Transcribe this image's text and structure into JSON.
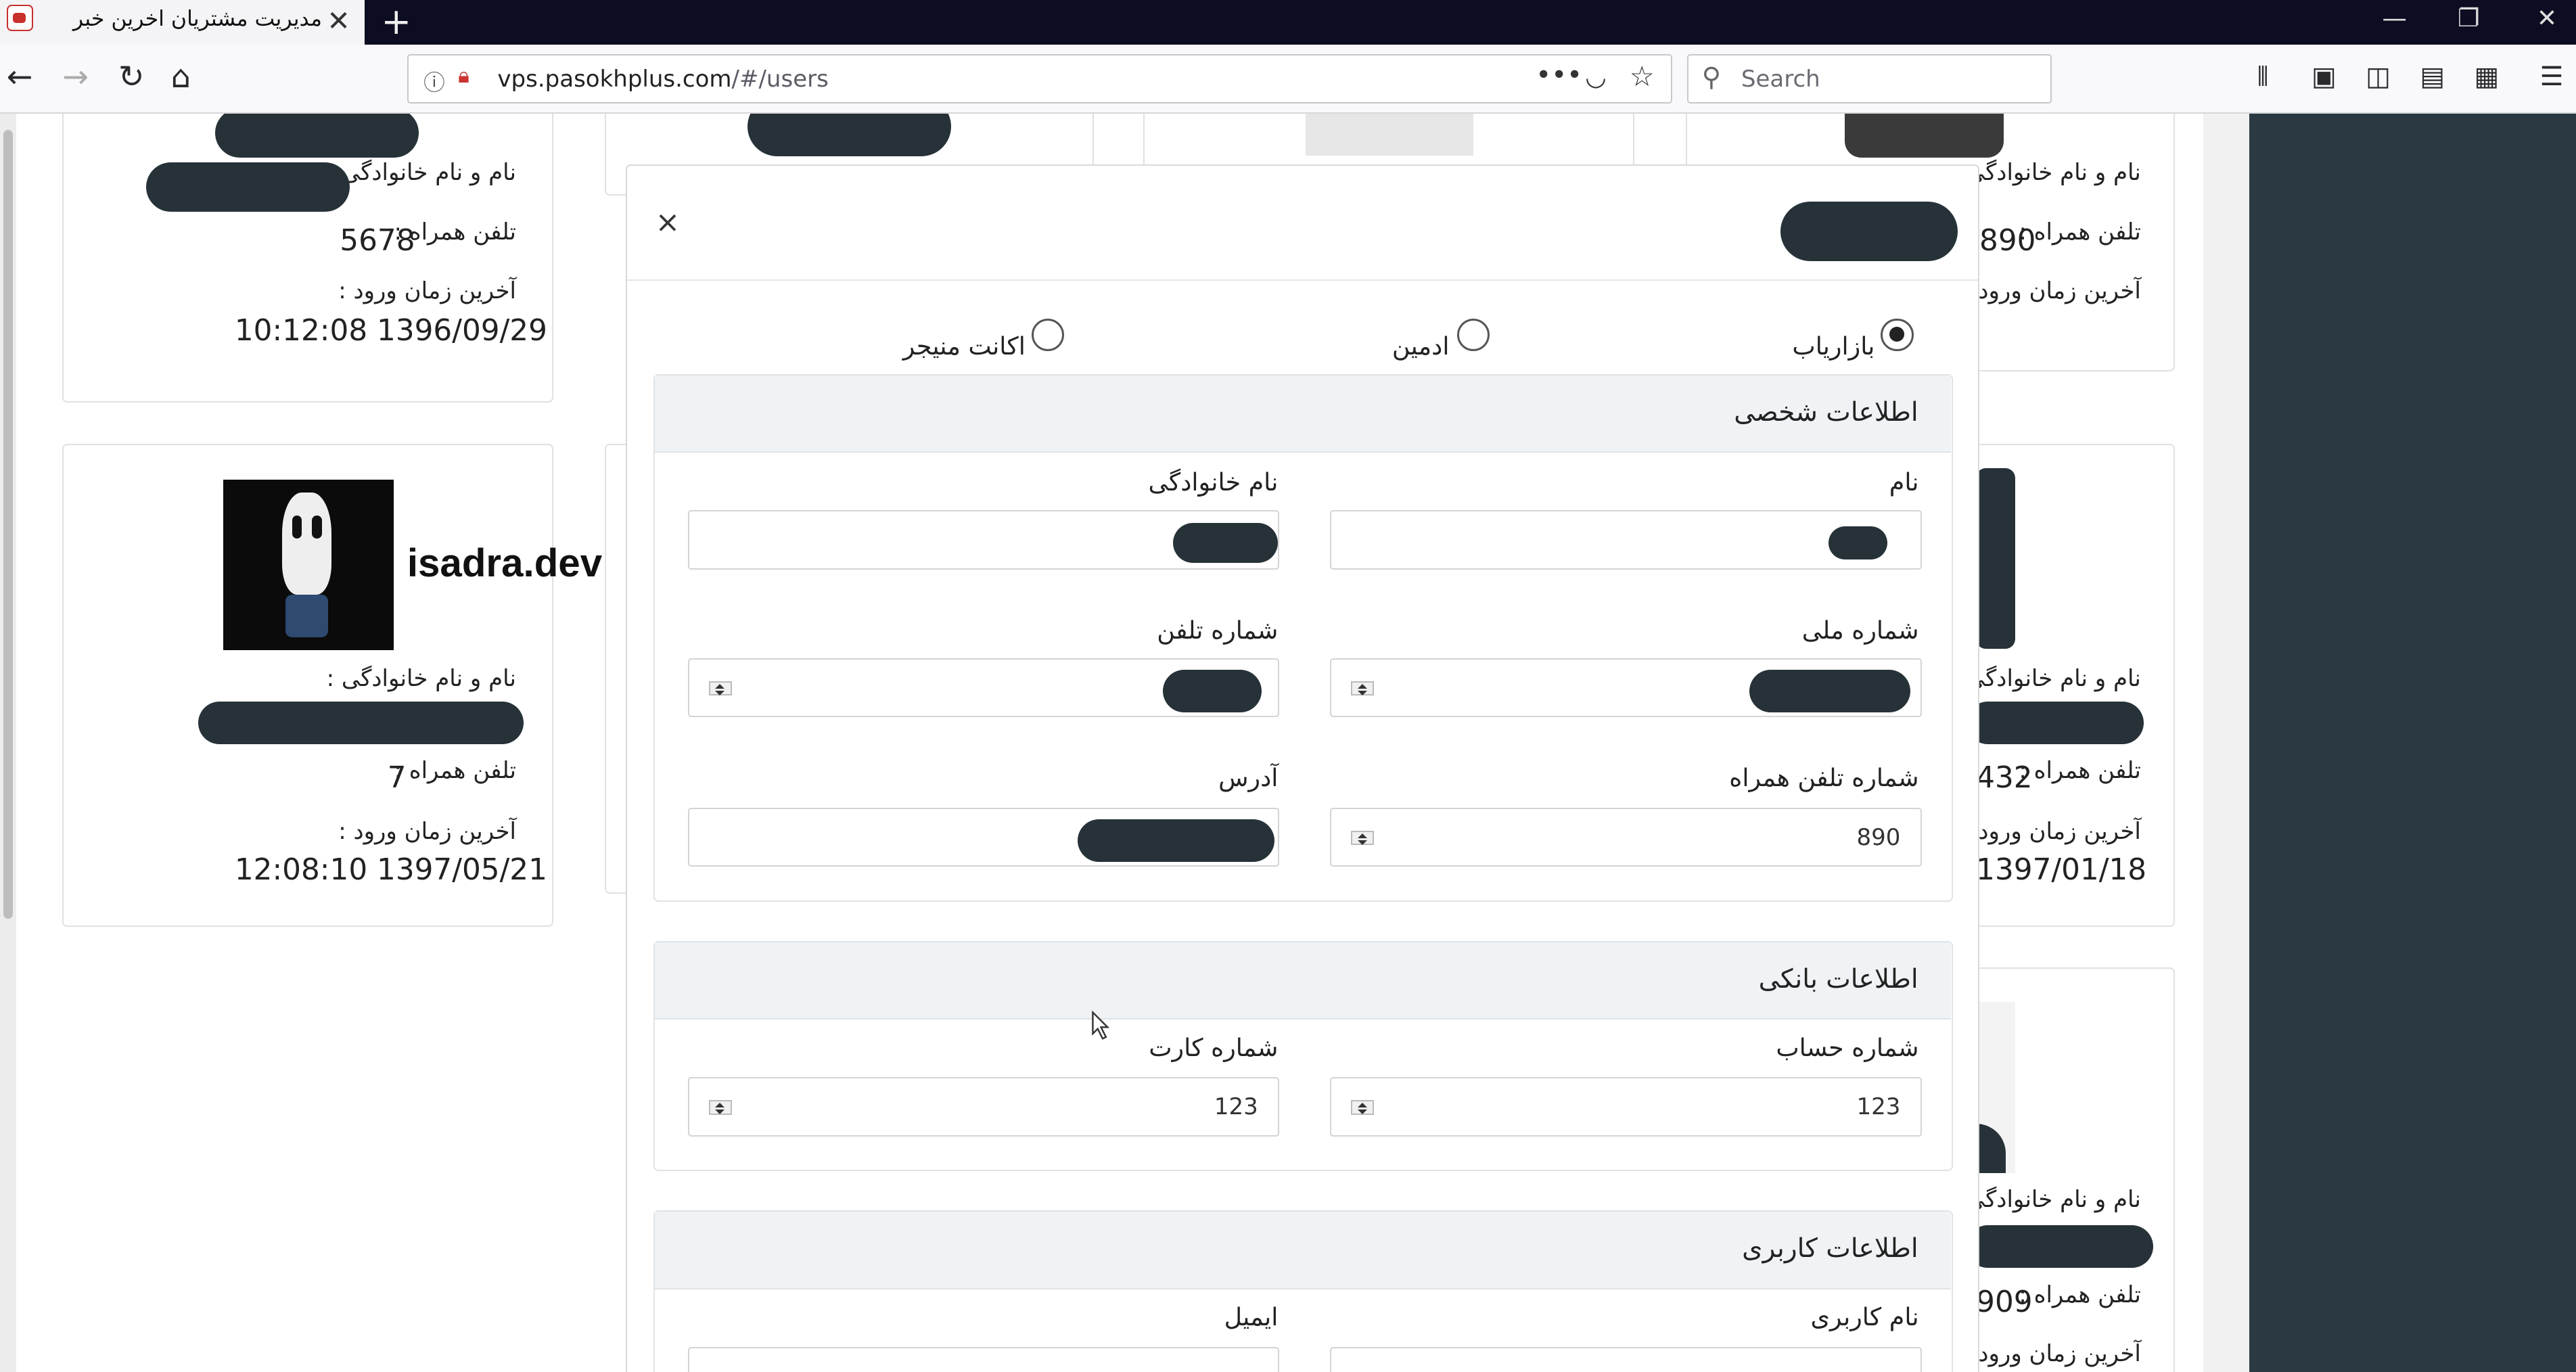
{
  "browser": {
    "tab_title": "مدیریت مشتریان اخرین خبر",
    "url_host": "vps.pasokhplus.com",
    "url_path": "/#/users",
    "search_placeholder": "Search"
  },
  "cards": {
    "label_fullname": "نام و نام خانوادگی :",
    "label_mobile": "تلفن همراه :",
    "label_last_login": "آخرین زمان ورود :",
    "card1": {
      "mobile": "5678",
      "last_login": "10:12:08 1396/09/29"
    },
    "card2": {
      "site": "isadra.dev",
      "mobile": "7",
      "last_login": "12:08:10 1397/05/21"
    },
    "right1": {
      "mobile": "890"
    },
    "right2": {
      "mobile": "432",
      "last_login": "1397/01/18"
    },
    "right3": {
      "mobile": "909"
    }
  },
  "modal": {
    "close": "×",
    "roles": [
      {
        "label": "بازاریاب",
        "checked": true
      },
      {
        "label": "ادمین",
        "checked": false
      },
      {
        "label": "اکانت منیجر",
        "checked": false
      }
    ],
    "personal": {
      "title": "اطلاعات شخصی",
      "first_name": "نام",
      "last_name": "نام خانوادگی",
      "national_id": "شماره ملی",
      "phone": "شماره تلفن",
      "mobile": "شماره تلفن همراه",
      "mobile_value": "890",
      "address": "آدرس"
    },
    "bank": {
      "title": "اطلاعات بانکی",
      "account_number": "شماره حساب",
      "account_value": "123",
      "card_number": "شماره کارت",
      "card_value": "123"
    },
    "user": {
      "title": "اطلاعات کاربری",
      "username": "نام کاربری",
      "email": "ایمیل"
    }
  }
}
